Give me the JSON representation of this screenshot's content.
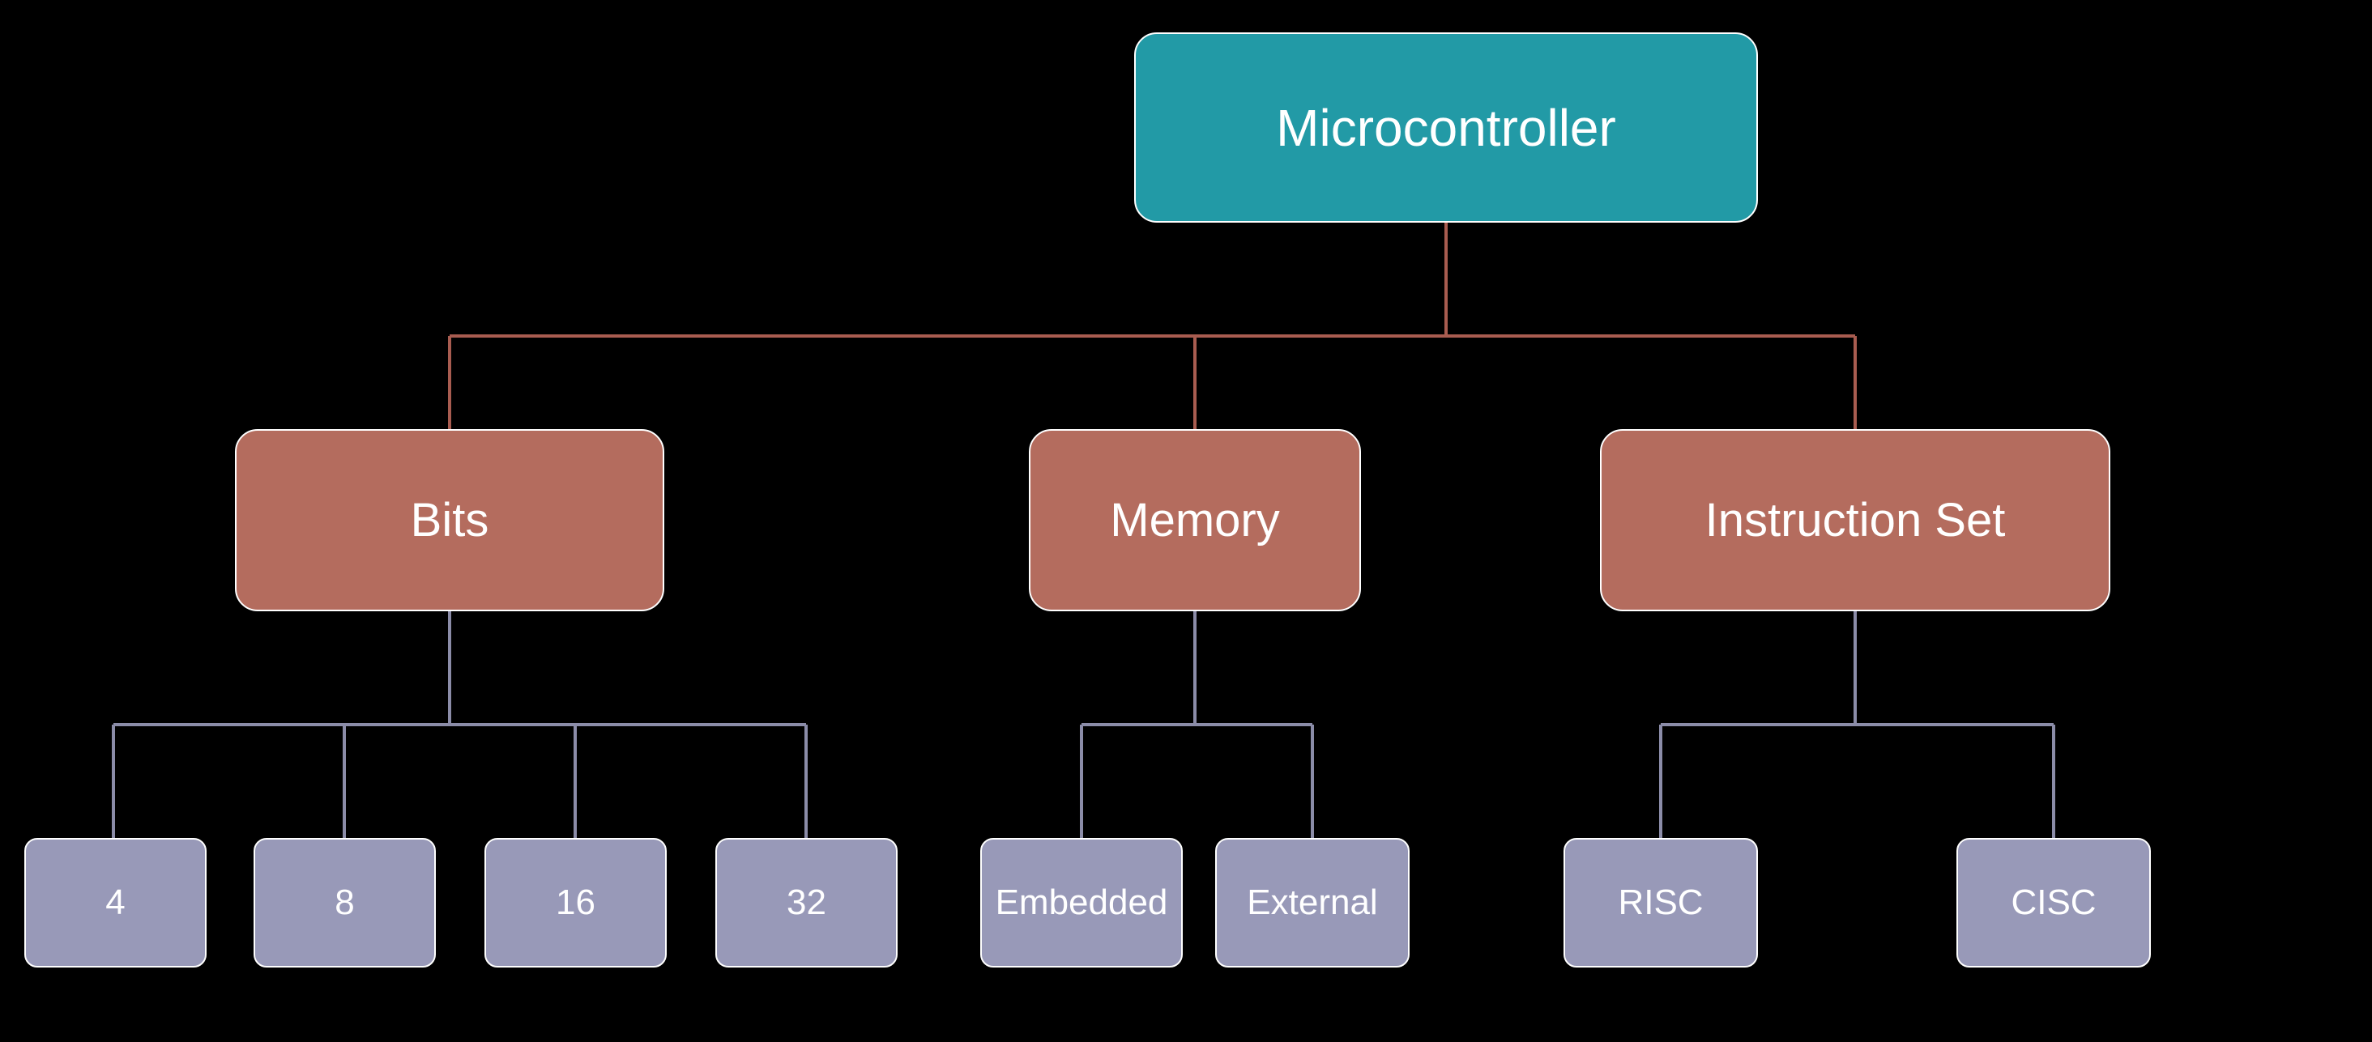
{
  "root": {
    "label": "Microcontroller"
  },
  "categories": {
    "bits": {
      "label": "Bits"
    },
    "memory": {
      "label": "Memory"
    },
    "instruction_set": {
      "label": "Instruction Set"
    }
  },
  "leaves": {
    "bits": [
      "4",
      "8",
      "16",
      "32"
    ],
    "memory": [
      "Embedded",
      "External"
    ],
    "instruction_set": [
      "RISC",
      "CISC"
    ]
  },
  "colors": {
    "root": "#229aa6",
    "category": "#b46c5e",
    "leaf": "#9899b8",
    "connector_root": "#a85c50",
    "connector_leaf": "#8b8ca8"
  }
}
